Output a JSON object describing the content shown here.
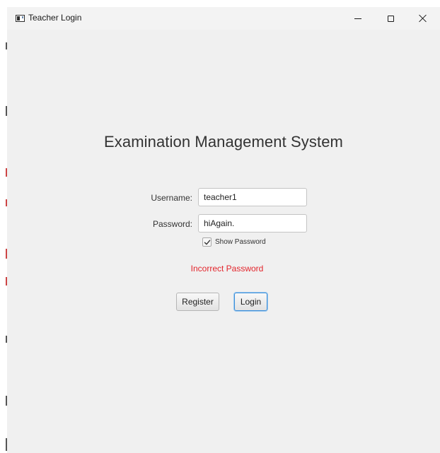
{
  "window": {
    "title": "Teacher Login"
  },
  "titlebar": {
    "icons": {
      "app": "app-window-icon",
      "minimize": "minimize-icon",
      "maximize": "maximize-icon",
      "close": "close-icon"
    }
  },
  "main": {
    "heading": "Examination Management System",
    "username": {
      "label": "Username:",
      "value": "teacher1"
    },
    "password": {
      "label": "Password:",
      "value": "hiAgain."
    },
    "show_password": {
      "label": "Show Password",
      "checked": true
    },
    "error_message": "Incorrect Password",
    "register_label": "Register",
    "login_label": "Login"
  },
  "colors": {
    "window_bg": "#f0f0f0",
    "error": "#e3242b",
    "focus_border": "#3c8fd9"
  }
}
